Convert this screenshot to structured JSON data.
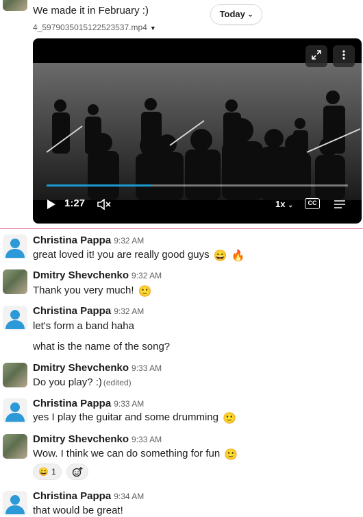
{
  "top_message": {
    "text": "We made it in February :)",
    "attachment": {
      "filename": "4_5979035015122523537.mp4"
    }
  },
  "date_divider": {
    "label": "Today"
  },
  "video": {
    "timestamp": "1:27",
    "speed": "1x",
    "captions_label": "CC",
    "progress": 0.35
  },
  "messages": [
    {
      "author": "Christina Pappa",
      "time": "9:32 AM",
      "lines": [
        "great loved it! you are really good guys"
      ],
      "emojis": [
        "😄",
        "🔥"
      ]
    },
    {
      "author": "Dmitry Shevchenko",
      "time": "9:32 AM",
      "lines": [
        "Thank you very much!"
      ],
      "emojis": [
        "🙂"
      ]
    },
    {
      "author": "Christina Pappa",
      "time": "9:32 AM",
      "lines": [
        "let's form a band haha",
        "what is the name of the song?"
      ]
    },
    {
      "author": "Dmitry Shevchenko",
      "time": "9:33 AM",
      "lines": [
        "Do you play? :)"
      ],
      "edited": "(edited)"
    },
    {
      "author": "Christina Pappa",
      "time": "9:33 AM",
      "lines": [
        "yes I play the guitar and some drumming"
      ],
      "emojis": [
        "🙂"
      ]
    },
    {
      "author": "Dmitry Shevchenko",
      "time": "9:33 AM",
      "lines": [
        "Wow. I think we can do something for fun"
      ],
      "emojis": [
        "🙂"
      ]
    },
    {
      "author": "Christina Pappa",
      "time": "9:34 AM",
      "lines": [
        "that would be great!"
      ]
    }
  ],
  "reactions": [
    {
      "emoji": "😄",
      "count": "1"
    }
  ],
  "colors": {
    "accent_blue": "#1d9bd1",
    "avatar_blue": "#2c9ad8",
    "unread": "#e01e5a"
  },
  "icons": [
    "fullscreen-icon",
    "more-icon",
    "play-icon",
    "mute-icon",
    "captions-icon",
    "menu-icon",
    "add-reaction-icon",
    "chevron-down-icon"
  ]
}
